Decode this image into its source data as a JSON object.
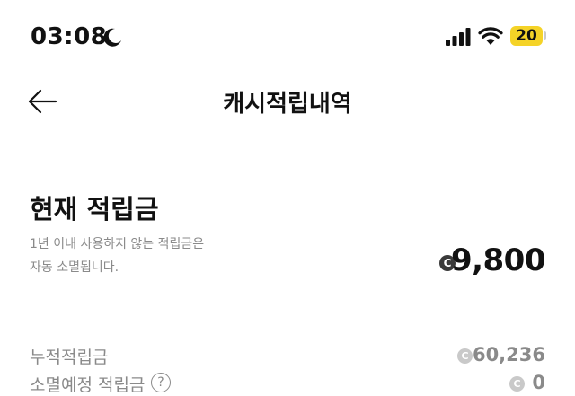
{
  "status_bar": {
    "time": "03:08",
    "moon_icon": "moon-icon",
    "signal_icon": "cellular-signal-icon",
    "wifi_icon": "wifi-icon",
    "battery_level": "20",
    "battery_color": "#f5d327"
  },
  "header": {
    "back_icon": "arrow-left-icon",
    "title": "캐시적립내역"
  },
  "current": {
    "title": "현재 적립금",
    "notice_line1": "1년 이내 사용하지 않는 적립금은",
    "notice_line2": "자동 소멸됩니다.",
    "coin_symbol": "C",
    "balance": "9,800"
  },
  "rows": [
    {
      "label": "누적적립금",
      "coin_symbol": "C",
      "value": "60,236"
    },
    {
      "label": "소멸예정 적립금",
      "help_icon": "?",
      "coin_symbol": "C",
      "value": "0"
    }
  ]
}
